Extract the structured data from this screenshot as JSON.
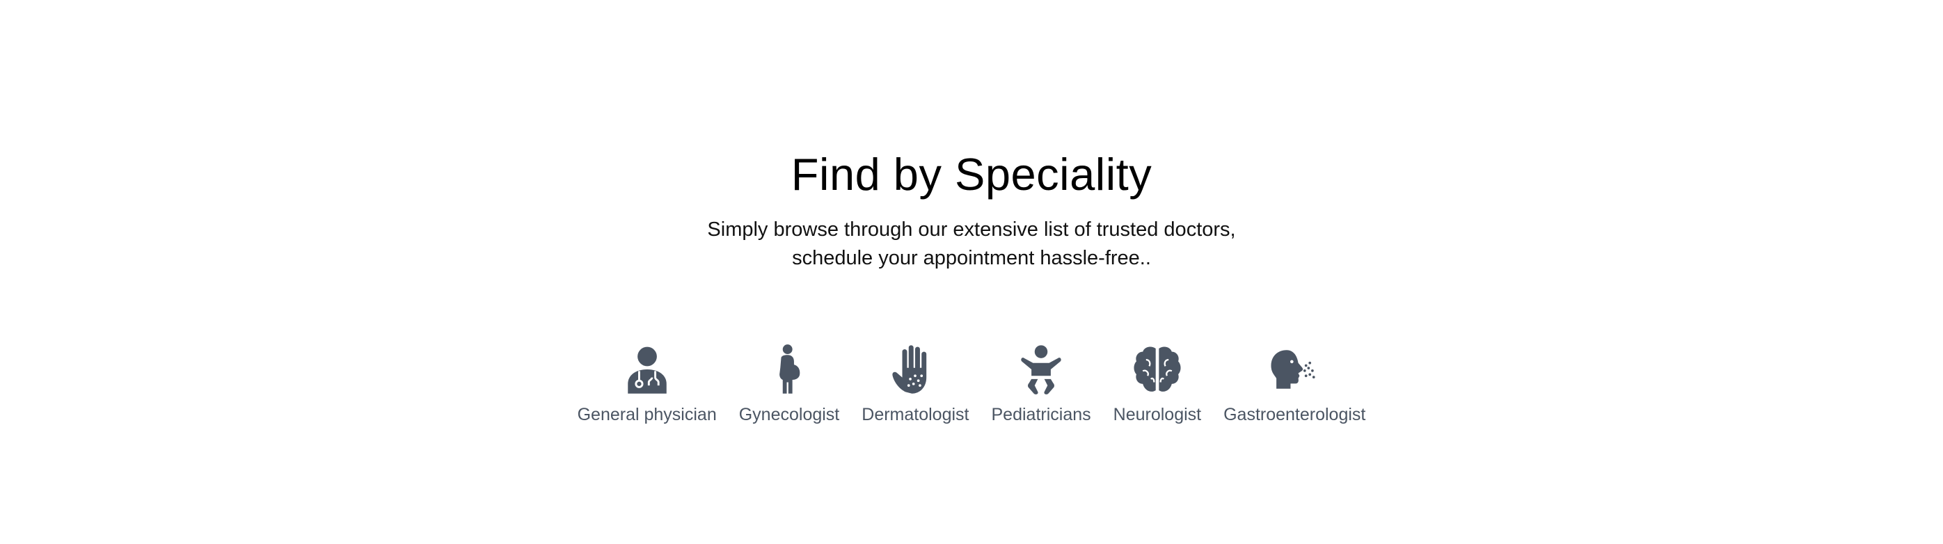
{
  "section": {
    "title": "Find by Speciality",
    "subtitle_line1": "Simply browse through our extensive list of trusted doctors,",
    "subtitle_line2": "schedule your appointment hassle-free.."
  },
  "specialities": [
    {
      "label": "General physician",
      "icon": "doctor-icon"
    },
    {
      "label": "Gynecologist",
      "icon": "pregnant-woman-icon"
    },
    {
      "label": "Dermatologist",
      "icon": "hand-dots-icon"
    },
    {
      "label": "Pediatricians",
      "icon": "baby-icon"
    },
    {
      "label": "Neurologist",
      "icon": "brain-icon"
    },
    {
      "label": "Gastroenterologist",
      "icon": "head-sneeze-icon"
    }
  ],
  "colors": {
    "icon": "#4b5563",
    "label": "#4b5563",
    "title": "#000000"
  }
}
